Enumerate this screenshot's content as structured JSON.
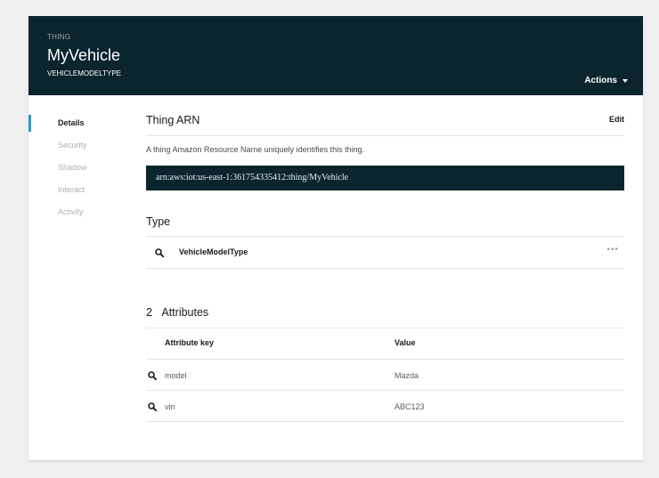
{
  "header": {
    "kind": "THING",
    "name": "MyVehicle",
    "type": "VEHICLEMODELTYPE",
    "actions_label": "Actions"
  },
  "sidenav": {
    "items": [
      {
        "label": "Details",
        "active": true
      },
      {
        "label": "Security"
      },
      {
        "label": "Shadow"
      },
      {
        "label": "Interact"
      },
      {
        "label": "Activity"
      }
    ]
  },
  "arn_section": {
    "title": "Thing ARN",
    "edit_label": "Edit",
    "description": "A thing Amazon Resource Name uniquely identifies this thing.",
    "arn": "arn:aws:iot:us-east-1:361754335412:thing/MyVehicle"
  },
  "type_section": {
    "title": "Type",
    "type_name": "VehicleModelType",
    "more_label": "•••"
  },
  "attributes_section": {
    "count": "2",
    "title": "Attributes",
    "columns": {
      "key": "Attribute key",
      "value": "Value"
    },
    "rows": [
      {
        "key": "model",
        "value": "Mazda"
      },
      {
        "key": "vin",
        "value": "ABC123"
      }
    ]
  },
  "colors": {
    "header_bg": "#0b252e",
    "accent": "#2e9ac9",
    "page_bg": "#efefef"
  }
}
